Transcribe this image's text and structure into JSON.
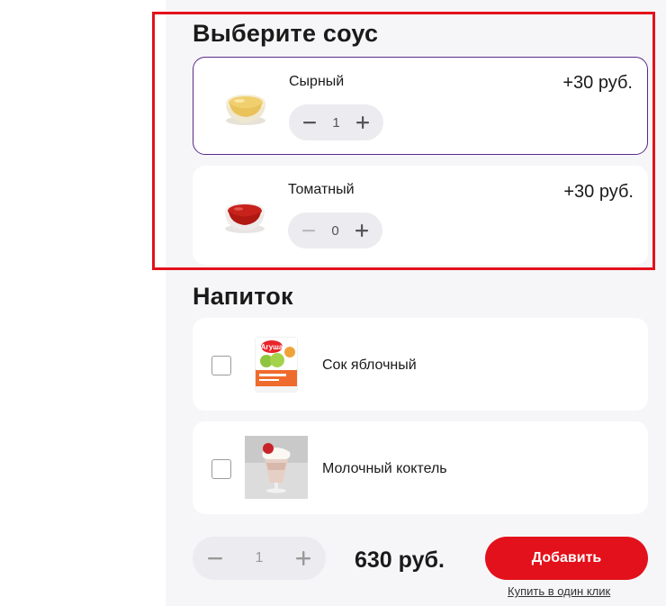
{
  "sauces": {
    "title": "Выберите соус",
    "items": [
      {
        "name": "Сырный",
        "price": "+30 руб.",
        "qty": "1",
        "icon": "cheese-sauce-bowl",
        "selected": true
      },
      {
        "name": "Томатный",
        "price": "+30 руб.",
        "qty": "0",
        "icon": "tomato-sauce-bowl",
        "selected": false
      }
    ]
  },
  "drinks": {
    "title": "Напиток",
    "items": [
      {
        "name": "Сок яблочный",
        "icon": "apple-juice-carton",
        "checked": false,
        "package_brand": "Агуша"
      },
      {
        "name": "Молочный коктель",
        "icon": "milkshake-glass",
        "checked": false
      }
    ]
  },
  "order": {
    "qty": "1",
    "total": "630 руб.",
    "add_label": "Добавить",
    "one_click_label": "Купить в один клик"
  },
  "colors": {
    "accent_red": "#e3111b",
    "selected_border": "#5b2a86",
    "panel_bg": "#f6f6f8",
    "stepper_bg": "#ececf0"
  }
}
